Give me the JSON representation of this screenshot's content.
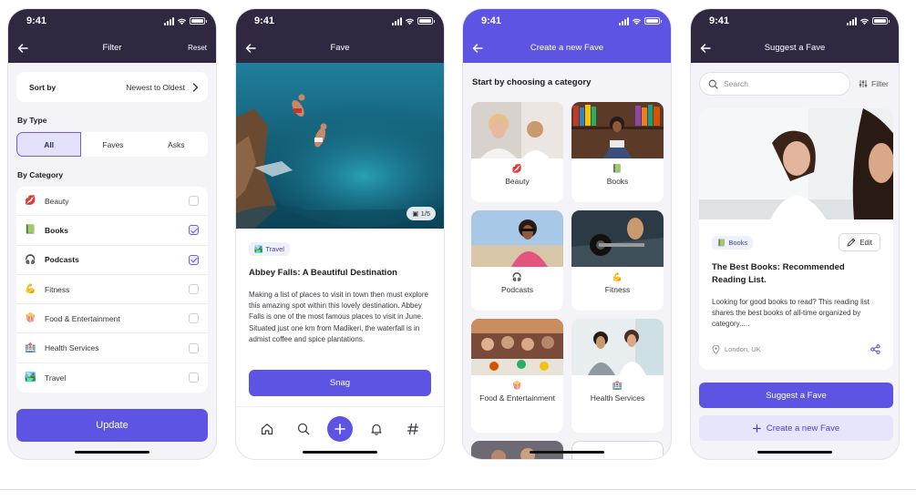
{
  "status": {
    "time": "9:41"
  },
  "filter_screen": {
    "title": "Filter",
    "reset_label": "Reset",
    "sort_label": "Sort by",
    "sort_value": "Newest to Oldest",
    "by_type_label": "By Type",
    "types": [
      "All",
      "Faves",
      "Asks"
    ],
    "selected_type": "All",
    "by_category_label": "By Category",
    "categories": [
      {
        "icon": "💋",
        "label": "Beauty",
        "checked": false
      },
      {
        "icon": "📗",
        "label": "Books",
        "checked": true
      },
      {
        "icon": "🎧",
        "label": "Podcasts",
        "checked": true
      },
      {
        "icon": "💪",
        "label": "Fitness",
        "checked": false
      },
      {
        "icon": "🍿",
        "label": "Food & Entertainment",
        "checked": false
      },
      {
        "icon": "🏥",
        "label": "Health Services",
        "checked": false
      },
      {
        "icon": "🏞️",
        "label": "Travel",
        "checked": false
      }
    ],
    "update_label": "Update"
  },
  "fave_screen": {
    "title": "Fave",
    "photo_counter": "1/5",
    "tag": {
      "icon": "🏞️",
      "label": "Travel"
    },
    "heading": "Abbey Falls: A Beautiful Destination",
    "body": "Making a list of places to visit in town then must explore this amazing spot within this lovely destination. Abbey Falls is one of the most famous places to visit in June. Situated just one km from Madikeri, the waterfall is in admist coffee and spice plantations.",
    "snag_label": "Snag"
  },
  "create_screen": {
    "title": "Create a new Fave",
    "heading": "Start by choosing a category",
    "tiles": [
      {
        "icon": "💋",
        "label": "Beauty"
      },
      {
        "icon": "📗",
        "label": "Books"
      },
      {
        "icon": "🎧",
        "label": "Podcasts"
      },
      {
        "icon": "💪",
        "label": "Fitness"
      },
      {
        "icon": "🍿",
        "label": "Food & Entertainment"
      },
      {
        "icon": "🏥",
        "label": "Health Services"
      }
    ]
  },
  "suggest_screen": {
    "title": "Suggest a Fave",
    "search_placeholder": "Search",
    "filter_label": "Filter",
    "tag": {
      "icon": "📗",
      "label": "Books"
    },
    "edit_label": "Edit",
    "heading": "The Best Books: Recommended Reading List.",
    "body": "Looking for good books to read? This reading list shares the best books of all-time organized by category.....",
    "location": "London, UK",
    "suggest_label": "Suggest a Fave",
    "create_label": "Create a new Fave"
  },
  "colors": {
    "accent": "#5e54e4",
    "header_dark": "#2f2840",
    "background": "#f4f3f7"
  }
}
